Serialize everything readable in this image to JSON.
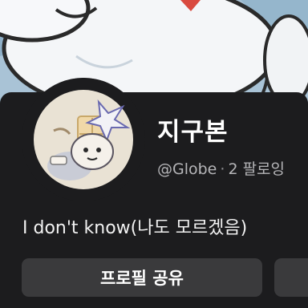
{
  "profile": {
    "display_name": "지구본",
    "handle": "@Globe",
    "separator": "·",
    "following_text": "2 팔로잉",
    "bio": "I don't know(나도 모르겠음)"
  },
  "actions": {
    "share_label": "프로필 공유",
    "next_label": ""
  },
  "icons": {
    "cover": "cartoon-cover-image",
    "avatar": "cartoon-character-avatar"
  },
  "colors": {
    "background": "#1c1c1e",
    "button": "#3a3a3c",
    "text_primary": "#ffffff",
    "text_secondary": "#b5b5b8"
  }
}
